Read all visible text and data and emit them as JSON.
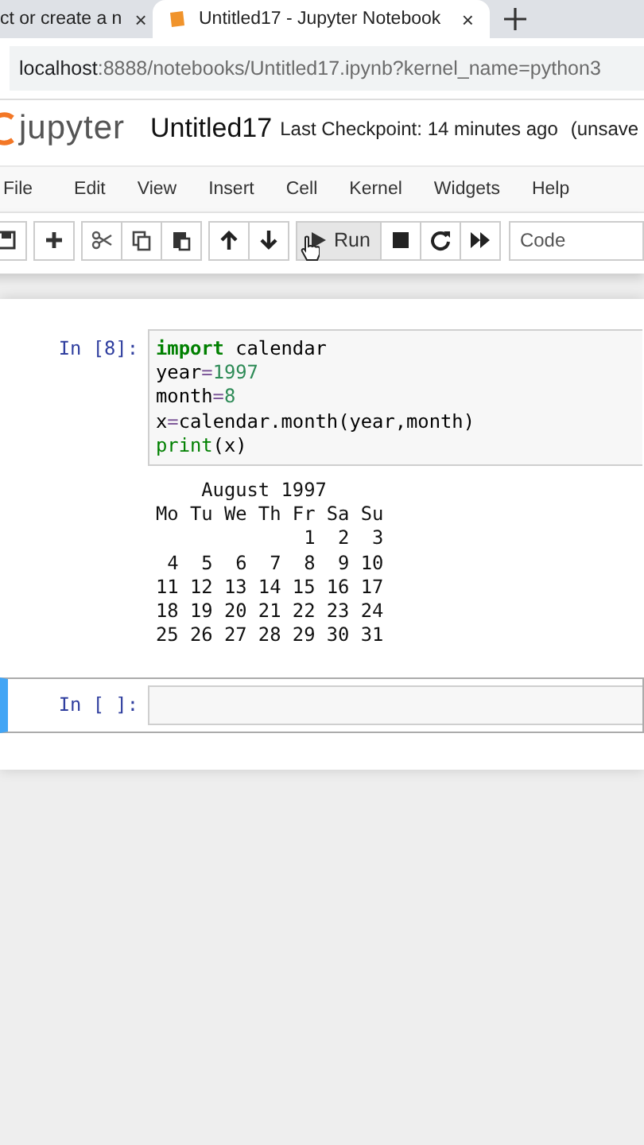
{
  "browser_tabs": [
    {
      "title": "ct or create a n",
      "close": "×",
      "selected": false,
      "has_icon": false
    },
    {
      "title": "Untitled17 - Jupyter Notebook",
      "close": "×",
      "selected": true,
      "has_icon": true
    }
  ],
  "address": {
    "host": "localhost",
    "path": ":8888/notebooks/Untitled17.ipynb?kernel_name=python3"
  },
  "header": {
    "logo_text": "jupyter",
    "notebook_title": "Untitled17",
    "checkpoint": "Last Checkpoint: 14 minutes ago",
    "status": "(unsave"
  },
  "menu": [
    "File",
    "Edit",
    "View",
    "Insert",
    "Cell",
    "Kernel",
    "Widgets",
    "Help"
  ],
  "toolbar": {
    "run_label": "Run",
    "cell_type": "Code"
  },
  "cells": [
    {
      "prompt": "In [8]:",
      "selected": false,
      "code": [
        [
          {
            "kind": "keyword",
            "text": "import"
          },
          {
            "kind": "plain",
            "text": " calendar"
          }
        ],
        [
          {
            "kind": "plain",
            "text": "year"
          },
          {
            "kind": "operator",
            "text": "="
          },
          {
            "kind": "number",
            "text": "1997"
          }
        ],
        [
          {
            "kind": "plain",
            "text": "month"
          },
          {
            "kind": "operator",
            "text": "="
          },
          {
            "kind": "number",
            "text": "8"
          }
        ],
        [
          {
            "kind": "plain",
            "text": "x"
          },
          {
            "kind": "operator",
            "text": "="
          },
          {
            "kind": "plain",
            "text": "calendar.month(year,month)"
          }
        ],
        [
          {
            "kind": "builtin",
            "text": "print"
          },
          {
            "kind": "plain",
            "text": "(x)"
          }
        ]
      ],
      "output": [
        "    August 1997",
        "Mo Tu We Th Fr Sa Su",
        "             1  2  3",
        " 4  5  6  7  8  9 10",
        "11 12 13 14 15 16 17",
        "18 19 20 21 22 23 24",
        "25 26 27 28 29 30 31"
      ]
    },
    {
      "prompt": "In [ ]:",
      "selected": true
    }
  ]
}
